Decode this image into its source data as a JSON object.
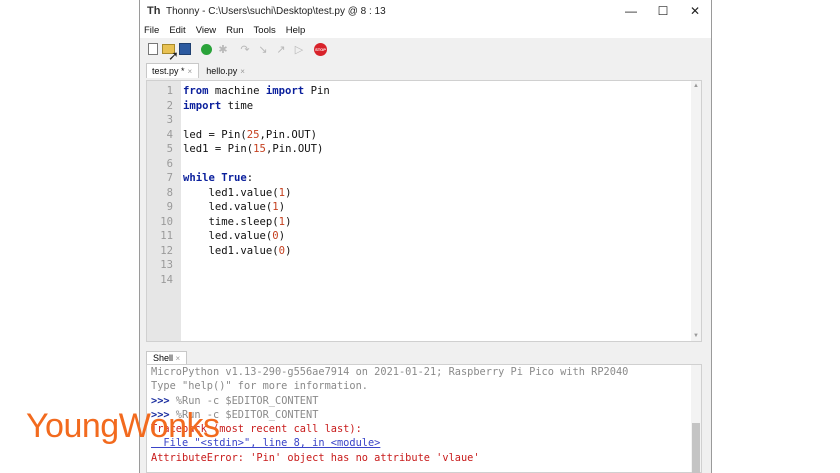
{
  "window": {
    "title": "Thonny  -  C:\\Users\\suchi\\Desktop\\test.py  @  8 : 13",
    "controls": [
      "—",
      "☐",
      "✕"
    ]
  },
  "menu": [
    "File",
    "Edit",
    "View",
    "Run",
    "Tools",
    "Help"
  ],
  "tabs": [
    {
      "label": "test.py *",
      "close": "×",
      "active": true
    },
    {
      "label": "hello.py",
      "close": "×",
      "active": false
    }
  ],
  "editor": {
    "line_numbers": [
      "1",
      "2",
      "3",
      "4",
      "5",
      "6",
      "7",
      "8",
      "9",
      "10",
      "11",
      "12",
      "13",
      "14"
    ],
    "lines": [
      [
        {
          "t": "from",
          "c": "kw"
        },
        {
          "t": " machine ",
          "c": "txt"
        },
        {
          "t": "import",
          "c": "kw"
        },
        {
          "t": " Pin",
          "c": "txt"
        }
      ],
      [
        {
          "t": "import",
          "c": "kw"
        },
        {
          "t": " time",
          "c": "txt"
        }
      ],
      [],
      [
        {
          "t": "led = Pin(",
          "c": "txt"
        },
        {
          "t": "25",
          "c": "num"
        },
        {
          "t": ",Pin.OUT)",
          "c": "txt"
        }
      ],
      [
        {
          "t": "led1 = Pin(",
          "c": "txt"
        },
        {
          "t": "15",
          "c": "num"
        },
        {
          "t": ",Pin.OUT)",
          "c": "txt"
        }
      ],
      [],
      [
        {
          "t": "while",
          "c": "kw"
        },
        {
          "t": " ",
          "c": "txt"
        },
        {
          "t": "True",
          "c": "kw"
        },
        {
          "t": ":",
          "c": "txt"
        }
      ],
      [
        {
          "t": "    led1.value(",
          "c": "txt"
        },
        {
          "t": "1",
          "c": "num"
        },
        {
          "t": ")",
          "c": "txt"
        }
      ],
      [
        {
          "t": "    led.value(",
          "c": "txt"
        },
        {
          "t": "1",
          "c": "num"
        },
        {
          "t": ")",
          "c": "txt"
        }
      ],
      [
        {
          "t": "    time.sleep(",
          "c": "txt"
        },
        {
          "t": "1",
          "c": "num"
        },
        {
          "t": ")",
          "c": "txt"
        }
      ],
      [
        {
          "t": "    led.value(",
          "c": "txt"
        },
        {
          "t": "0",
          "c": "num"
        },
        {
          "t": ")",
          "c": "txt"
        }
      ],
      [
        {
          "t": "    led1.value(",
          "c": "txt"
        },
        {
          "t": "0",
          "c": "num"
        },
        {
          "t": ")",
          "c": "txt"
        }
      ],
      [],
      []
    ]
  },
  "shell": {
    "tab_label": "Shell",
    "tab_close": "×",
    "banner": "MicroPython v1.13-290-g556ae7914 on 2021-01-21; Raspberry Pi Pico with RP2040",
    "help_hint": "Type \"help()\" for more information.",
    "run_lines": [
      {
        "prompt": ">>>",
        "cmd": " %Run -c $EDITOR_CONTENT"
      },
      {
        "prompt": ">>>",
        "cmd": " %Run -c $EDITOR_CONTENT"
      }
    ],
    "traceback_head": "Traceback (most recent call last):",
    "traceback_file": "  File \"<stdin>\", line 8, in <module>",
    "error": "AttributeError: 'Pin' object has no attribute 'vlaue'"
  },
  "watermark": {
    "part1": "Young",
    "part2": "Wonks"
  },
  "icons": [
    "new-file-icon",
    "open-file-icon",
    "save-icon",
    "run-icon",
    "debug-icon",
    "step-over-icon",
    "step-into-icon",
    "step-out-icon",
    "resume-icon",
    "stop-icon"
  ],
  "colors": {
    "keyword": "#0a1f9c",
    "number": "#c5401f",
    "error": "#c81b1b",
    "brand": "#f26a1e"
  }
}
